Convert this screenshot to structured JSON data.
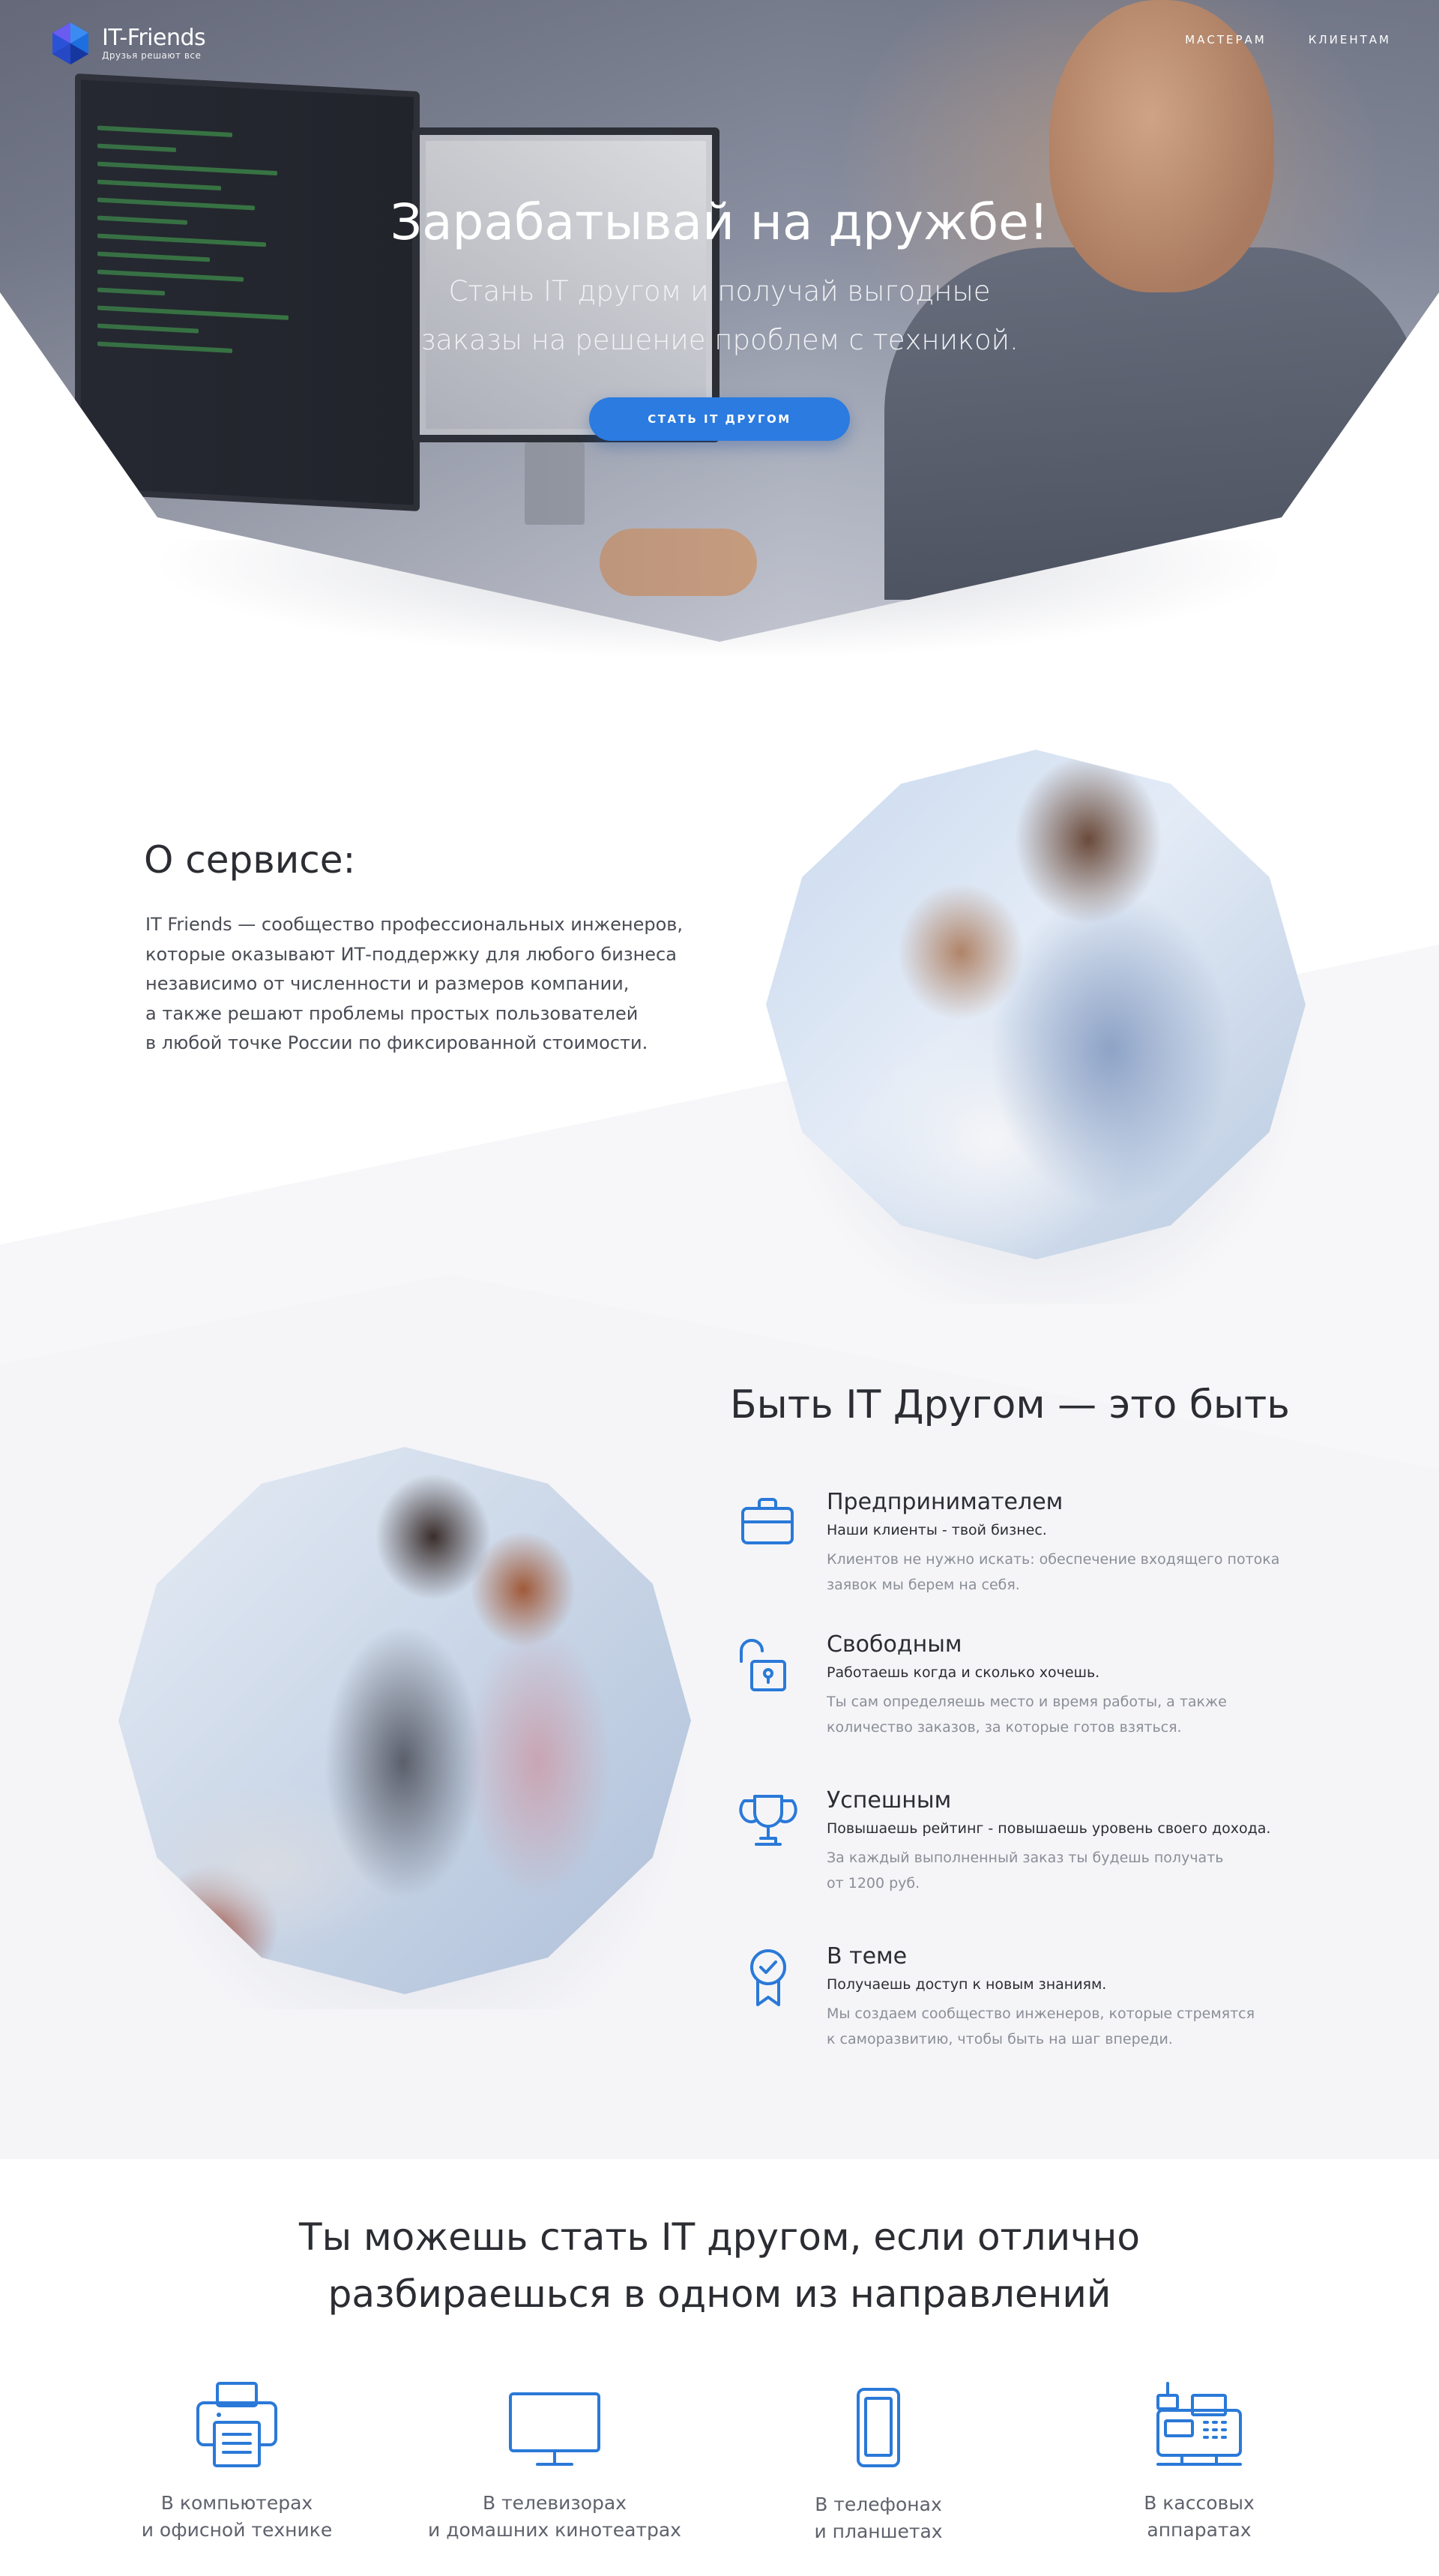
{
  "brand": {
    "name": "IT-Friends",
    "tagline": "Друзья решают все"
  },
  "nav": {
    "items": [
      {
        "label": "МАСТЕРАМ"
      },
      {
        "label": "КЛИЕНТАМ"
      }
    ]
  },
  "hero": {
    "title": "Зарабатывай на дружбе!",
    "subtitle_line1": "Стань IT другом и получай выгодные",
    "subtitle_line2": "заказы на решение проблем с техникой.",
    "cta_label": "СТАТЬ IT ДРУГОМ"
  },
  "about": {
    "title": "О сервисе:",
    "lines": [
      "IT Friends — сообщество профессиональных инженеров,",
      "которые оказывают ИТ-поддержку для любого бизнеса",
      "независимо от численности и размеров компании,",
      "а также решают проблемы простых пользователей",
      "в любой точке России по фиксированной стоимости."
    ]
  },
  "benefits": {
    "title": "Быть IT Другом — это быть",
    "items": [
      {
        "icon": "briefcase-icon",
        "title": "Предпринимателем",
        "lead": "Наши клиенты - твой бизнес.",
        "desc_line1": "Клиентов не нужно искать: обеспечение входящего потока",
        "desc_line2": "заявок мы берем на себя."
      },
      {
        "icon": "unlocked-padlock-icon",
        "title": "Свободным",
        "lead": "Работаешь когда и сколько хочешь.",
        "desc_line1": "Ты сам определяешь место и время работы, а также",
        "desc_line2": "количество заказов, за которые готов взяться."
      },
      {
        "icon": "trophy-icon",
        "title": "Успешным",
        "lead": "Повышаешь рейтинг - повышаешь уровень своего дохода.",
        "desc_line1": "За каждый выполненный заказ ты будешь получать",
        "desc_line2": "от 1200 руб."
      },
      {
        "icon": "award-badge-icon",
        "title": "В теме",
        "lead": "Получаешь доступ к новым знаниям.",
        "desc_line1": "Мы создаем сообщество инженеров, которые стремятся",
        "desc_line2": "к саморазвитию, чтобы быть на шаг впереди."
      }
    ]
  },
  "directions": {
    "title_line1": "Ты можешь стать IT другом, если отлично",
    "title_line2": "разбираешься в одном из направлений",
    "items": [
      {
        "icon": "printer-icon",
        "line1": "В компьютерах",
        "line2": "и офисной технике"
      },
      {
        "icon": "tv-monitor-icon",
        "line1": "В телевизорах",
        "line2": "и домашних кинотеатрах"
      },
      {
        "icon": "smartphone-icon",
        "line1": "В телефонах",
        "line2": "и планшетах"
      },
      {
        "icon": "cash-register-icon",
        "line1": "В кассовых",
        "line2": "аппаратах"
      }
    ]
  },
  "colors": {
    "accent": "#2b7be0",
    "icon": "#2a79d8",
    "text_dark": "#2b2d33",
    "text_muted": "#8b8e98"
  }
}
